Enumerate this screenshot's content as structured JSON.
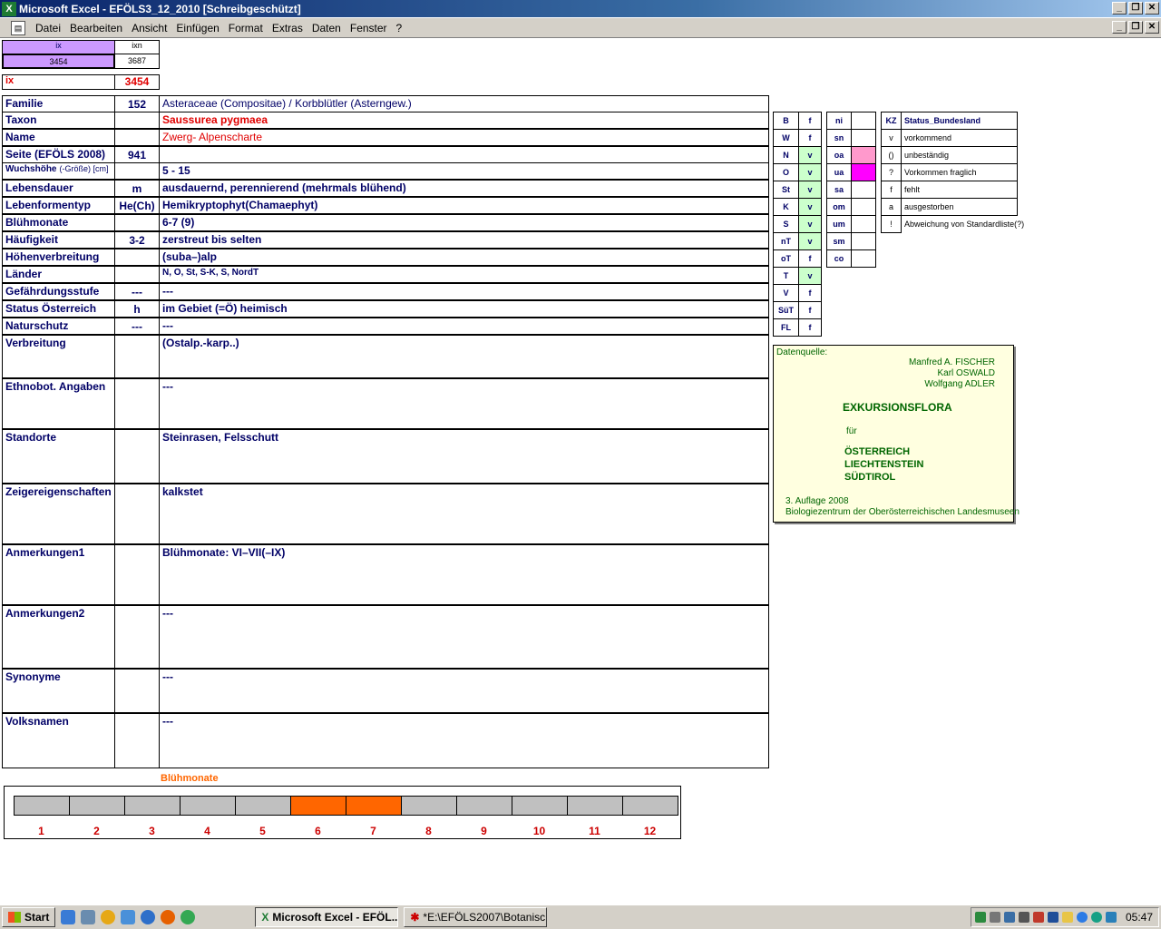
{
  "window": {
    "title": "Microsoft Excel - EFÖLS3_12_2010  [Schreibgeschützt]",
    "app_icon": "excel-icon"
  },
  "menu": [
    "Datei",
    "Bearbeiten",
    "Ansicht",
    "Einfügen",
    "Format",
    "Extras",
    "Daten",
    "Fenster",
    "?"
  ],
  "index": {
    "ix_header": "ix",
    "ix_value": "3454",
    "ixn_header": "ixn",
    "ixn_value": "3687",
    "ix_label": "ix",
    "ix_current": "3454"
  },
  "rows": [
    {
      "label": "Familie",
      "code": "152",
      "value": "Asteraceae (Compositae)  /  Korbblütler (Asterngew.)"
    },
    {
      "label": "Taxon",
      "code": "",
      "value": "Saussurea pygmaea"
    },
    {
      "label": "Name",
      "code": "",
      "value": "Zwerg- Alpenscharte"
    },
    {
      "label": "Seite (EFÖLS 2008)",
      "code": "941",
      "value": ""
    },
    {
      "label": "Wuchshöhe",
      "label_suffix": "(-Größe) [cm]",
      "code": "",
      "value": "5 - 15"
    },
    {
      "label": "Lebensdauer",
      "code": "m",
      "value": "ausdauernd, perennierend (mehrmals blühend)"
    },
    {
      "label": "Lebenformentyp",
      "code": "He(Ch)",
      "value": "Hemikryptophyt(Chamaephyt)"
    },
    {
      "label": "Blühmonate",
      "code": "",
      "value": "6-7 (9)"
    },
    {
      "label": "Häufigkeit",
      "code": "3-2",
      "value": "zerstreut bis selten"
    },
    {
      "label": "Höhenverbreitung",
      "code": "",
      "value": "(suba–)alp"
    },
    {
      "label": "Länder",
      "code": "",
      "value": "N, O, St, S-K, S, NordT"
    },
    {
      "label": "Gefährdungsstufe",
      "code": "---",
      "value": "---"
    },
    {
      "label": "Status Österreich",
      "code": "h",
      "value": "im Gebiet (=Ö) heimisch"
    },
    {
      "label": "Naturschutz",
      "code": "---",
      "value": "---"
    },
    {
      "label": "Verbreitung",
      "code": "",
      "value": "(Ostalp.-karp..)"
    },
    {
      "label": "Ethnobot. Angaben",
      "code": "",
      "value": "---"
    },
    {
      "label": "Standorte",
      "code": "",
      "value": "Steinrasen, Felsschutt"
    },
    {
      "label": "Zeigereigenschaften",
      "code": "",
      "value": "kalkstet"
    },
    {
      "label": "Anmerkungen1",
      "code": "",
      "value": "Blühmonate: VI–VII(–IX)"
    },
    {
      "label": "Anmerkungen2",
      "code": "",
      "value": "---"
    },
    {
      "label": "Synonyme",
      "code": "",
      "value": "---"
    },
    {
      "label": "Volksnamen",
      "code": "",
      "value": "---"
    }
  ],
  "laender": [
    {
      "k": "B",
      "v": "f"
    },
    {
      "k": "W",
      "v": "f"
    },
    {
      "k": "N",
      "v": "v"
    },
    {
      "k": "O",
      "v": "v"
    },
    {
      "k": "St",
      "v": "v"
    },
    {
      "k": "K",
      "v": "v"
    },
    {
      "k": "S",
      "v": "v"
    },
    {
      "k": "nT",
      "v": "v"
    },
    {
      "k": "oT",
      "v": "f"
    },
    {
      "k": "T",
      "v": "v"
    },
    {
      "k": "V",
      "v": "f"
    },
    {
      "k": "SüT",
      "v": "f"
    },
    {
      "k": "FL",
      "v": "f"
    }
  ],
  "hoehen": [
    {
      "k": "ni",
      "color": ""
    },
    {
      "k": "sn",
      "color": ""
    },
    {
      "k": "oa",
      "color": "#ff99cc"
    },
    {
      "k": "ua",
      "color": "#ff00ff"
    },
    {
      "k": "sa",
      "color": ""
    },
    {
      "k": "om",
      "color": ""
    },
    {
      "k": "um",
      "color": ""
    },
    {
      "k": "sm",
      "color": ""
    },
    {
      "k": "co",
      "color": ""
    }
  ],
  "status_legend": {
    "header_kz": "KZ",
    "header_title": "Status_Bundesland",
    "items": [
      {
        "k": "v",
        "t": "vorkommend"
      },
      {
        "k": "()",
        "t": "unbeständig"
      },
      {
        "k": "?",
        "t": "Vorkommen fraglich"
      },
      {
        "k": "f",
        "t": "fehlt"
      },
      {
        "k": "a",
        "t": "ausgestorben"
      },
      {
        "k": "!",
        "t": "Abweichung von Standardliste(?)"
      }
    ]
  },
  "datenquelle": {
    "label": "Datenquelle:",
    "authors": [
      "Manfred A. FISCHER",
      "Karl OSWALD",
      "Wolfgang ADLER"
    ],
    "title": "EXKURSIONSFLORA",
    "fuer": "für",
    "countries": [
      "ÖSTERREICH",
      "LIECHTENSTEIN",
      "SÜDTIROL"
    ],
    "edition": "3. Auflage 2008",
    "publisher": "Biologiezentrum der Oberösterreichischen Landesmuseen"
  },
  "chart_data": {
    "type": "bar",
    "title": "Blühmonate",
    "categories": [
      "1",
      "2",
      "3",
      "4",
      "5",
      "6",
      "7",
      "8",
      "9",
      "10",
      "11",
      "12"
    ],
    "values": [
      0,
      0,
      0,
      0,
      0,
      1,
      1,
      0,
      0,
      0,
      0,
      0
    ],
    "colors": {
      "active": "#ff6600",
      "inactive": "#c0c0c0"
    }
  },
  "taskbar": {
    "start": "Start",
    "tasks": [
      {
        "label": "Microsoft Excel - EFÖL...",
        "active": true
      },
      {
        "label": "*E:\\EFÖLS2007\\Botanisc...",
        "active": false
      }
    ],
    "clock": "05:47"
  }
}
